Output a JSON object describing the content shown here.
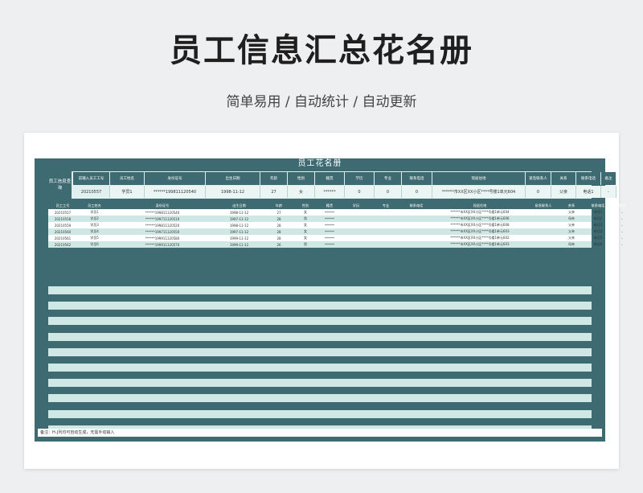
{
  "page": {
    "title": "员工信息汇总花名册",
    "subtitle": "简单易用 / 自动统计 / 自动更新"
  },
  "sheet": {
    "title": "员工花名册",
    "query": {
      "label": "员工信息查询",
      "headers": [
        "前输入员工工号",
        "员工姓名",
        "身份证号",
        "出生日期",
        "年龄",
        "性别",
        "籍贯",
        "学历",
        "专业",
        "联系电话",
        "现居住地",
        "紧急联系人",
        "关系",
        "联系电话",
        "备注"
      ],
      "values": [
        "20210557",
        "学员1",
        "******199811120540",
        "1998-11-12",
        "27",
        "女",
        "******",
        "0",
        "0",
        "0",
        "******市XX区XX小区****号楼1单元604",
        "0",
        "父亲",
        "电话1",
        "-"
      ]
    },
    "table": {
      "headers": [
        "员工工号",
        "员工姓名",
        "身份证号",
        "出生日期",
        "年龄",
        "性别",
        "籍贯",
        "学历",
        "专业",
        "联系电话",
        "现居住地",
        "紧急联系人",
        "关系",
        "联系电话",
        "备注"
      ],
      "rows": [
        [
          "20210557",
          "学员1",
          "******199811120540",
          "1998-11-12",
          "27",
          "女",
          "******",
          "",
          "",
          "",
          "******市XX区XX小区****号楼1单元604",
          "",
          "父亲",
          "电话1",
          "-"
        ],
        [
          "20210558",
          "学员2",
          "******199711120510",
          "1997-11-12",
          "28",
          "男",
          "******",
          "",
          "",
          "",
          "******市XX区XX小区****号楼1单元606",
          "",
          "母亲",
          "电话2",
          "-"
        ],
        [
          "20210559",
          "学员3",
          "******199811120520",
          "1998-11-12",
          "28",
          "女",
          "******",
          "",
          "",
          "",
          "******市XX区XX小区****号楼1单元608",
          "",
          "父亲",
          "电话3",
          "-"
        ],
        [
          "20210560",
          "学员4",
          "******199711120550",
          "1997-11-12",
          "28",
          "女",
          "******",
          "",
          "",
          "",
          "******市XX区XX小区****号楼1单元603",
          "",
          "父亲",
          "电话4",
          "-"
        ],
        [
          "20210561",
          "学员5",
          "******199911120580",
          "1999-11-12",
          "28",
          "女",
          "******",
          "",
          "",
          "",
          "******市XX区XX小区****号楼1单元602",
          "",
          "父亲",
          "电话5",
          "-"
        ],
        [
          "20210562",
          "学员6",
          "******199911120570",
          "1999-11-12",
          "26",
          "男",
          "******",
          "",
          "",
          "",
          "******市XX区XX小区****号楼1单元603",
          "",
          "母亲",
          "电话6",
          "-"
        ]
      ],
      "empty_stripes": 10
    },
    "note": "备注：H-J列均可自动生成，无需手动输入"
  },
  "colors": {
    "frame": "#3e6b71",
    "stripe": "#cfe8e6",
    "query_bg": "#dff0ef"
  }
}
